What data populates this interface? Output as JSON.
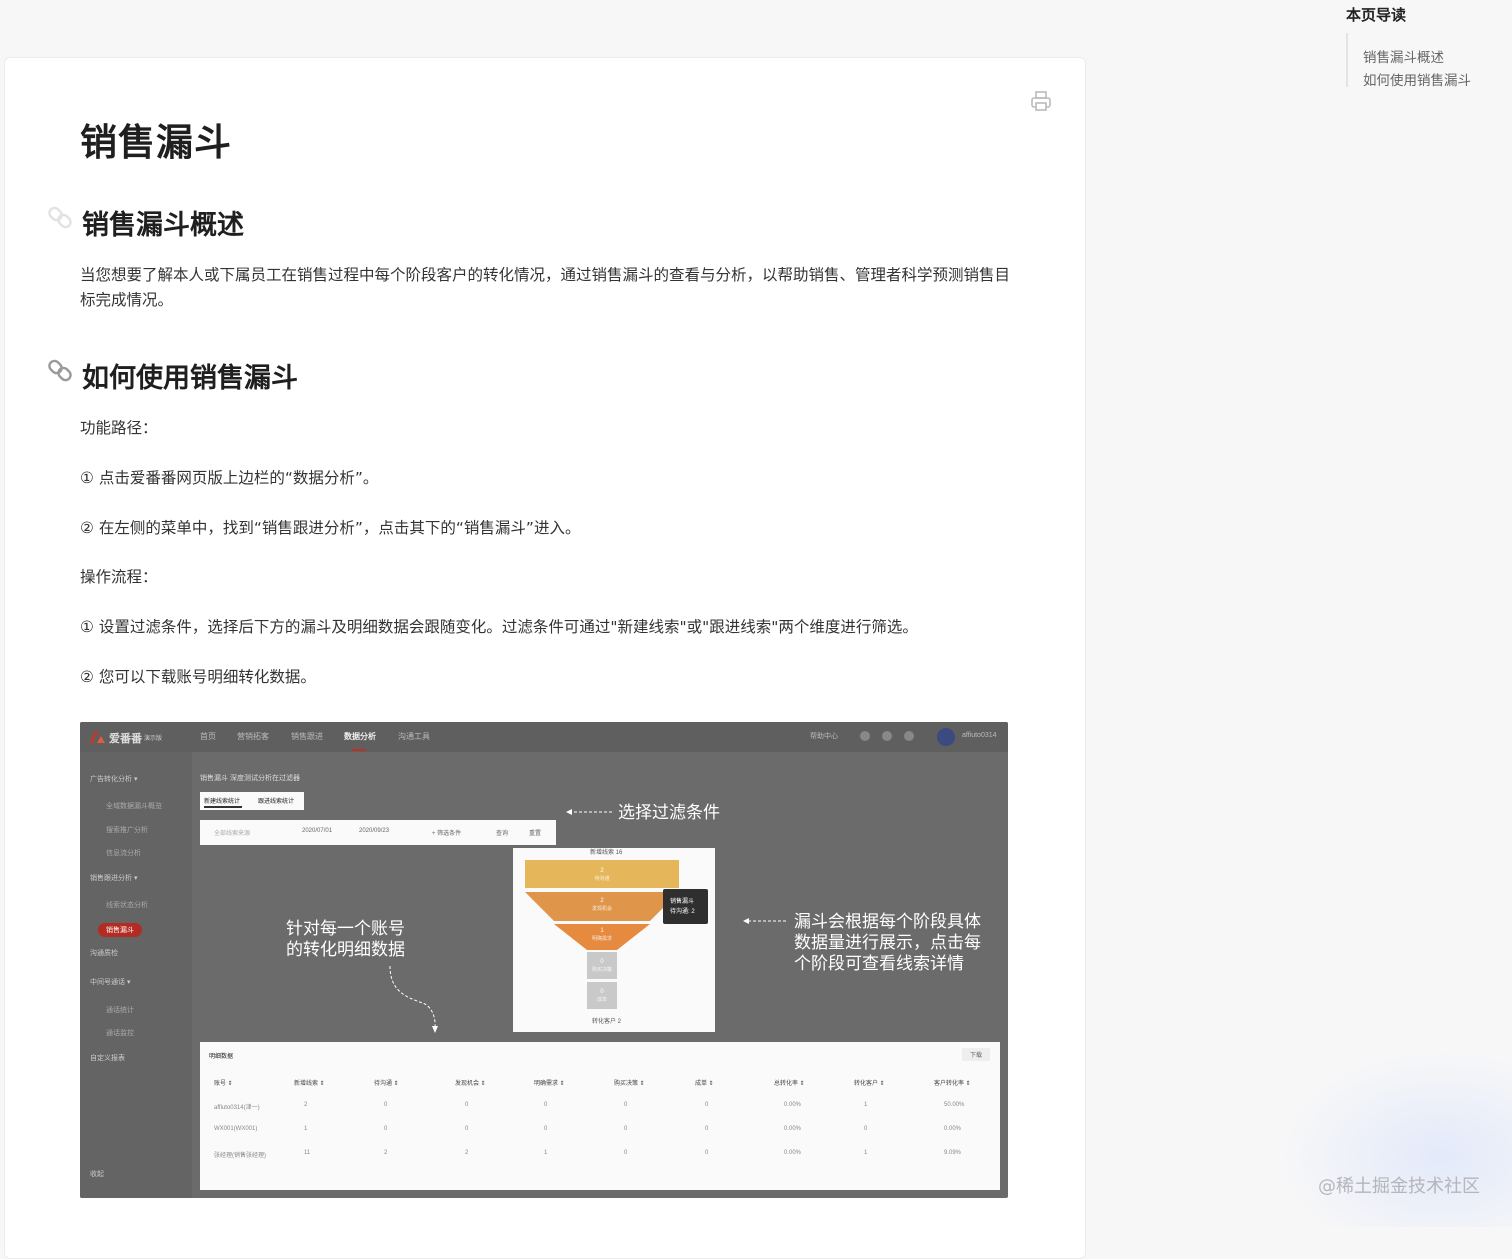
{
  "doc": {
    "title": "销售漏斗",
    "sections": [
      {
        "heading": "销售漏斗概述"
      },
      {
        "heading": "如何使用销售漏斗"
      }
    ],
    "paragraphs": [
      "当您想要了解本人或下属员工在销售过程中每个阶段客户的转化情况，通过销售漏斗的查看与分析，以帮助销售、管理者科学预测销售目标完成情况。",
      "功能路径：",
      "① 点击爱番番网页版上边栏的“数据分析”。",
      "② 在左侧的菜单中，找到“销售跟进分析”，点击其下的“销售漏斗”进入。",
      "操作流程：",
      "① 设置过滤条件，选择后下方的漏斗及明细数据会跟随变化。过滤条件可通过\"新建线索\"或\"跟进线索\"两个维度进行筛选。",
      "② 您可以下载账号明细转化数据。"
    ]
  },
  "toc": {
    "title": "本页导读",
    "items": [
      "销售漏斗概述",
      "如何使用销售漏斗"
    ]
  },
  "screenshot": {
    "logo_text": "爱番番",
    "logo_sub": "演示版",
    "nav": [
      "首页",
      "营销拓客",
      "销售跟进",
      "数据分析",
      "沟通工具"
    ],
    "nav_active": 3,
    "nav_right": "帮助中心",
    "user": "affiuto0314",
    "sidebar": [
      {
        "label": "广告转化分析 ▾",
        "kind": "group"
      },
      {
        "label": "全域数据漏斗概览",
        "kind": "sub"
      },
      {
        "label": "搜索推广分析",
        "kind": "sub"
      },
      {
        "label": "信息流分析",
        "kind": "sub"
      },
      {
        "label": "销售跟进分析 ▾",
        "kind": "group"
      },
      {
        "label": "线索状态分析",
        "kind": "sub"
      },
      {
        "label": "销售漏斗",
        "kind": "active"
      },
      {
        "label": "沟通质检",
        "kind": "group"
      },
      {
        "label": "中间号通话 ▾",
        "kind": "group"
      },
      {
        "label": "通话统计",
        "kind": "sub"
      },
      {
        "label": "通话监控",
        "kind": "sub"
      },
      {
        "label": "自定义报表",
        "kind": "group"
      },
      {
        "label": "收起",
        "kind": "group"
      }
    ],
    "breadcrumb": "销售漏斗  深度测试分析在过滤器",
    "tabs": [
      "新建线索统计",
      "跟进线索统计"
    ],
    "filter": {
      "source_placeholder": "全部线索来源",
      "date_start": "2020/07/01",
      "date_end": "2020/09/23",
      "more": "+ 筛选条件",
      "query": "查询",
      "reset": "重置"
    },
    "funnel": {
      "top_label": "新增线索 16",
      "bottom_label": "转化客户 2",
      "tooltip_title": "销售漏斗",
      "tooltip_value": "待沟通: 2",
      "stages": [
        {
          "value": "2",
          "label": "待沟通",
          "color": "#e6b75a"
        },
        {
          "value": "2",
          "label": "发现机会",
          "color": "#e0964a"
        },
        {
          "value": "1",
          "label": "明确需求",
          "color": "#e58a3e"
        },
        {
          "value": "0",
          "label": "购买决策",
          "color": "#c9c9c9"
        },
        {
          "value": "0",
          "label": "成单",
          "color": "#c9c9c9"
        }
      ]
    },
    "annotations": {
      "filter": "选择过滤条件",
      "account": [
        "针对每一个账号",
        "的转化明细数据"
      ],
      "funnel": [
        "漏斗会根据每个阶段具体",
        "数据量进行展示，点击每",
        "个阶段可查看线索详情"
      ]
    },
    "table": {
      "title": "明细数据",
      "download": "下载",
      "headers": [
        "账号 ⇕",
        "新增线索 ⇕",
        "待沟通 ⇕",
        "发现机会 ⇕",
        "明确需求 ⇕",
        "购买决策 ⇕",
        "成单 ⇕",
        "总转化率 ⇕",
        "转化客户 ⇕",
        "客户转化率 ⇕"
      ],
      "rows": [
        [
          "affiuto0314(津一)",
          "2",
          "0",
          "0",
          "0",
          "0",
          "0",
          "0.00%",
          "1",
          "50.00%"
        ],
        [
          "WX001(WX001)",
          "1",
          "0",
          "0",
          "0",
          "0",
          "0",
          "0.00%",
          "0",
          "0.00%"
        ],
        [
          "张经理(销售张经理)",
          "11",
          "2",
          "2",
          "1",
          "0",
          "0",
          "0.00%",
          "1",
          "9.09%"
        ]
      ]
    }
  },
  "watermark": "@稀土掘金技术社区",
  "colors": {
    "accent": "#b32b22",
    "screenshot_bg": "#6b6b6b"
  }
}
